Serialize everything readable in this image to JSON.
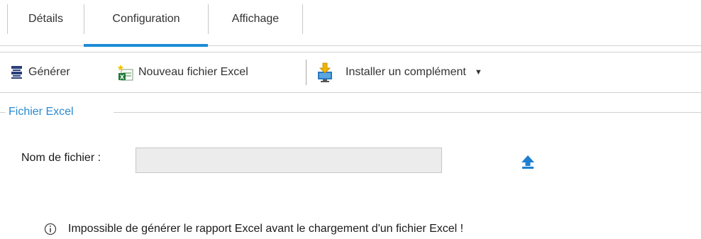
{
  "tabs": [
    {
      "label": "Détails",
      "active": false
    },
    {
      "label": "Configuration",
      "active": true
    },
    {
      "label": "Affichage",
      "active": false
    }
  ],
  "toolbar": {
    "generate_label": "Générer",
    "new_excel_label": "Nouveau fichier Excel",
    "install_addin_label": "Installer un complément",
    "install_caret": "▼"
  },
  "section": {
    "title": "Fichier Excel"
  },
  "file_field": {
    "label": "Nom de fichier :",
    "value": "",
    "placeholder": ""
  },
  "upload_icon": "upload-icon",
  "info_message": "Impossible de générer le rapport Excel avant le chargement d'un fichier Excel !",
  "colors": {
    "accent": "#1e8cd6",
    "section_title": "#2a8ad0",
    "input_bg": "#ececec"
  }
}
